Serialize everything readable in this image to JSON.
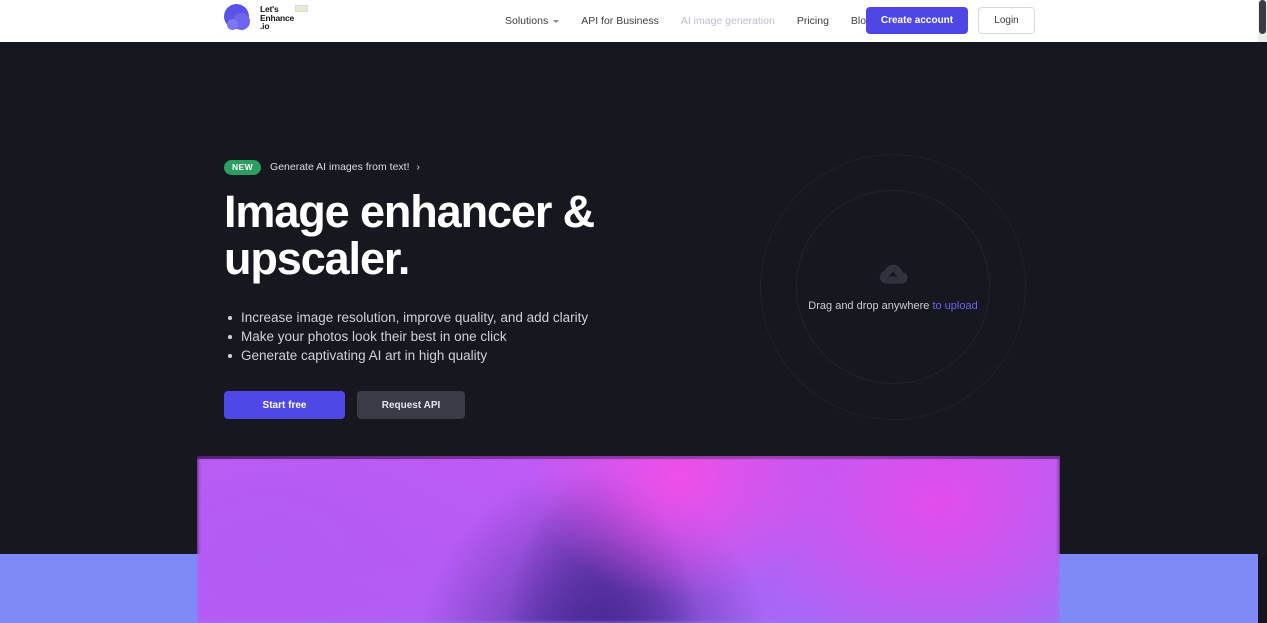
{
  "brand": {
    "name_line1": "Let's",
    "name_line2": "Enhance",
    "name_line3": ".io",
    "flag_icon": "flag-icon"
  },
  "nav": {
    "items": [
      {
        "label": "Solutions",
        "has_chevron": true,
        "muted": false
      },
      {
        "label": "API for Business",
        "has_chevron": false,
        "muted": false
      },
      {
        "label": "AI image generation",
        "has_chevron": false,
        "muted": true
      },
      {
        "label": "Pricing",
        "has_chevron": false,
        "muted": false
      },
      {
        "label": "Blog",
        "has_chevron": false,
        "muted": false
      }
    ]
  },
  "header_actions": {
    "create_account": "Create account",
    "login": "Login"
  },
  "hero": {
    "badge": "NEW",
    "badge_text": "Generate AI images from text!",
    "badge_arrow": "›",
    "title": "Image enhancer & upscaler.",
    "bullets": [
      "Increase image resolution, improve quality, and add clarity",
      "Make your photos look their best in one click",
      "Generate captivating AI art in high quality"
    ],
    "cta_primary": "Start free",
    "cta_secondary": "Request API"
  },
  "dropzone": {
    "icon": "cloud-upload-icon",
    "text": "Drag and drop anywhere ",
    "link_text": "to upload"
  },
  "colors": {
    "brand_purple": "#4e46e5",
    "accent_link": "#6a63ef",
    "badge_green": "#2b9e62",
    "hero_bg": "#17171f",
    "header_bg": "#ffffff",
    "band_blue": "#8089f8"
  }
}
